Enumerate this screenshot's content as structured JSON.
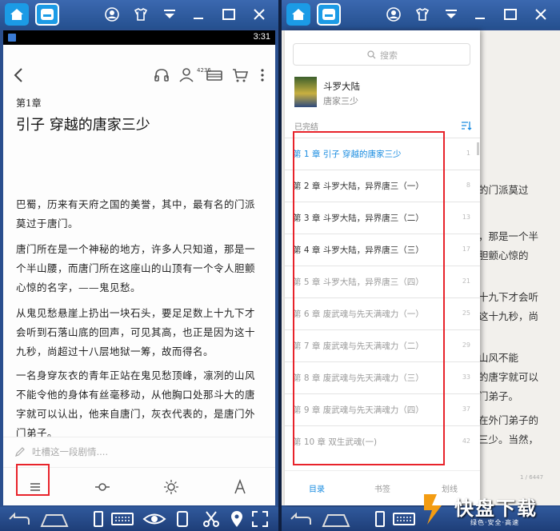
{
  "left": {
    "status_time": "3:31",
    "badge_count": "4236",
    "chapter_number": "第1章",
    "chapter_title": "引子 穿越的唐家三少",
    "paragraphs": [
      "巴蜀，历来有天府之国的美誉，其中，最有名的门派莫过于唐门。",
      "唐门所在是一个神秘的地方，许多人只知道，那是一个半山腰，而唐门所在这座山的山顶有一个令人胆颤心惊的名字，——鬼见愁。",
      "从鬼见愁悬崖上扔出一块石头，要足足数上十九下才会听到石落山底的回声，可见其高，也正是因为这十九秒，尚超过十八层地狱一筹，故而得名。",
      "一名身穿灰衣的青年正站在鬼见愁顶峰，凛冽的山风不能令他的身体有丝毫移动，从他胸口处那斗大的唐字就可以认出，他来自唐门，灰衣代表的，是唐门外门弟子。"
    ],
    "comment_placeholder": "吐槽这一段剧情...."
  },
  "right": {
    "search_placeholder": "搜索",
    "book_title": "斗罗大陆",
    "book_author": "唐家三少",
    "book_status": "已完结",
    "chapters": [
      {
        "label": "第 1 章  引子 穿越的唐家三少",
        "page": "1",
        "state": "current"
      },
      {
        "label": "第 2 章  斗罗大陆，异界唐三（一）",
        "page": "8",
        "state": "read"
      },
      {
        "label": "第 3 章  斗罗大陆，异界唐三（二）",
        "page": "13",
        "state": "read"
      },
      {
        "label": "第 4 章  斗罗大陆，异界唐三（三）",
        "page": "17",
        "state": "read"
      },
      {
        "label": "第 5 章  斗罗大陆，异界唐三（四）",
        "page": "21",
        "state": "unread"
      },
      {
        "label": "第 6 章  废武魂与先天满魂力（一）",
        "page": "25",
        "state": "unread"
      },
      {
        "label": "第 7 章  废武魂与先天满魂力（二）",
        "page": "29",
        "state": "unread"
      },
      {
        "label": "第 8 章  废武魂与先天满魂力（三）",
        "page": "33",
        "state": "unread"
      },
      {
        "label": "第 9 章  废武魂与先天满魂力（四）",
        "page": "37",
        "state": "unread"
      },
      {
        "label": "第 10 章  双生武魂(一)",
        "page": "42",
        "state": "unread"
      }
    ],
    "tabs": {
      "toc": "目录",
      "bookmarks": "书签",
      "notes": "划线"
    },
    "bg_lines": [
      {
        "text": "的门派莫过",
        "row": 0
      },
      {
        "text": "，那是一个半",
        "row": 1
      },
      {
        "text": "胆颤心惊的",
        "row": 2
      },
      {
        "text": "十九下才会听",
        "row": 3
      },
      {
        "text": "这十九秒，尚",
        "row": 4
      },
      {
        "text": "山风不能",
        "row": 5
      },
      {
        "text": "的唐字就可以",
        "row": 6
      },
      {
        "text": "门弟子。",
        "row": 7
      },
      {
        "text": "在外门弟子的",
        "row": 8
      },
      {
        "text": "三少。当然，",
        "row": 9
      }
    ],
    "page_indicator": "1 / 6447",
    "watermark_main": "快盘下载",
    "watermark_sub": "绿色·安全·高速"
  },
  "colors": {
    "accent": "#1a8ce0",
    "highlight_box": "#e8232b"
  }
}
